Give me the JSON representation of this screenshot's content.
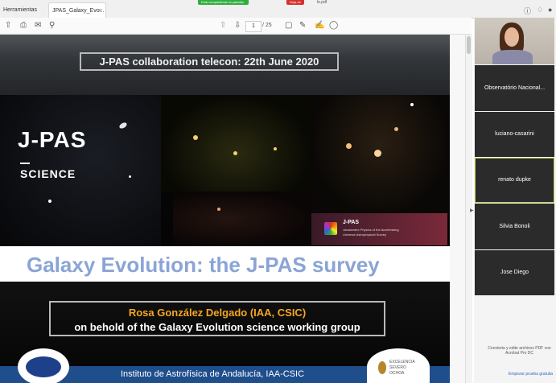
{
  "tabs": {
    "tools": "Herramientas",
    "document": "JPAS_Galaxy_Evo...",
    "close": "×"
  },
  "share_bar": {
    "sharing_text": "Está compartiendo la pantalla",
    "stop_text": "Deja de",
    "file_suffix": "le.pdf"
  },
  "toolbar": {
    "page_current": "1",
    "page_total": "/ 25"
  },
  "slide": {
    "telecon": "J-PAS collaboration telecon: 22th June 2020",
    "logo_title": "J-PAS",
    "logo_sub": "SCIENCE",
    "jpas_box_title": "J-PAS",
    "jpas_box_line1": "Javalambre Physics of the Accelerating",
    "jpas_box_line2": "Universe Astrophysical Survey",
    "title": "Galaxy Evolution: the J-PAS survey",
    "author": "Rosa González Delgado (IAA, CSIC)",
    "behalf": "on behold of the Galaxy Evolution science working group",
    "institute": "Instituto de Astrofísica de Andalucía, IAA-CSIC",
    "excellence_1": "EXCELENCIA",
    "excellence_2": "SEVERO",
    "excellence_3": "OCHOA"
  },
  "participants": [
    "Observatório Nacional...",
    "luciano-casarini",
    "renato dupke",
    "Silvia Bonoli",
    "Jose Diego"
  ],
  "promo": {
    "text": "Convierta y edite archivos PDF con Acrobat Pro DC",
    "link": "Empezar prueba gratuita"
  }
}
